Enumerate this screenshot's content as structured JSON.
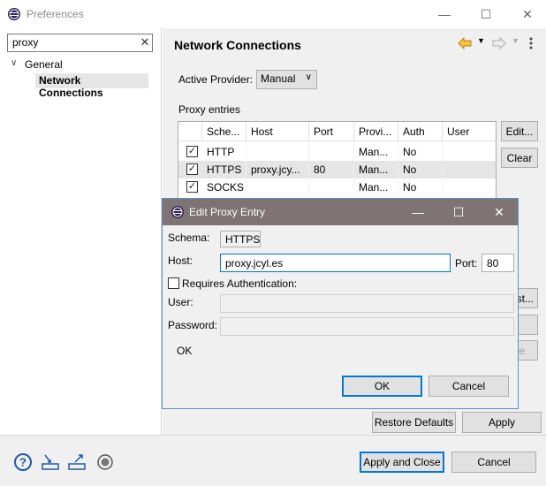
{
  "window": {
    "title": "Preferences",
    "controls": {
      "minimize": "—",
      "maximize": "☐",
      "close": "✕"
    }
  },
  "left": {
    "filter_value": "proxy",
    "tree": [
      {
        "label": "General",
        "expanded": true
      },
      {
        "label": "Network Connections",
        "selected": true
      }
    ]
  },
  "page": {
    "title": "Network Connections",
    "active_provider_label": "Active Provider:",
    "active_provider_value": "Manual",
    "proxy_entries_label": "Proxy entries",
    "table": {
      "headers": [
        "",
        "Sche...",
        "Host",
        "Port",
        "Provi...",
        "Auth",
        "User"
      ],
      "rows": [
        {
          "checked": true,
          "schema": "HTTP",
          "host": "",
          "port": "",
          "provider": "Man...",
          "auth": "No",
          "user": ""
        },
        {
          "checked": true,
          "schema": "HTTPS",
          "host": "proxy.jcy...",
          "port": "80",
          "provider": "Man...",
          "auth": "No",
          "user": "",
          "selected": true
        },
        {
          "checked": true,
          "schema": "SOCKS",
          "host": "",
          "port": "",
          "provider": "Man...",
          "auth": "No",
          "user": ""
        }
      ]
    },
    "buttons": {
      "edit": "Edit...",
      "clear": "Clear",
      "partial1": "st...",
      "partial2": "e",
      "restore_defaults": "Restore Defaults",
      "apply": "Apply"
    }
  },
  "dialog": {
    "title": "Edit Proxy Entry",
    "controls": {
      "minimize": "—",
      "maximize": "☐",
      "close": "✕"
    },
    "schema_label": "Schema:",
    "schema_value": "HTTPS",
    "host_label": "Host:",
    "host_value": "proxy.jcyl.es",
    "port_label": "Port:",
    "port_value": "80",
    "requires_auth_label": "Requires Authentication:",
    "requires_auth_checked": false,
    "user_label": "User:",
    "user_value": "",
    "password_label": "Password:",
    "password_value": "",
    "status": "OK",
    "ok_button": "OK",
    "cancel_button": "Cancel"
  },
  "bottom": {
    "apply_and_close": "Apply and Close",
    "cancel": "Cancel",
    "icons": [
      "help-icon",
      "import-icon",
      "export-icon",
      "record-icon"
    ]
  },
  "colors": {
    "accent": "#0078d7",
    "dialog_title_bg": "#7f7474",
    "eclipse_logo": "#2c2255",
    "nav_back": "#e8a80c"
  }
}
